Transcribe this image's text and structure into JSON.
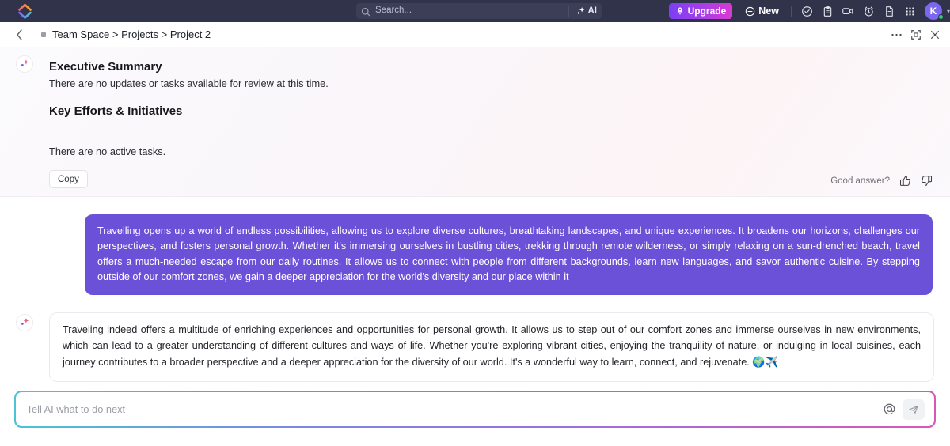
{
  "topbar": {
    "logo_icon": "clickup-logo-icon",
    "search": {
      "icon": "search-icon",
      "placeholder": "Search...",
      "ai_label": "AI",
      "ai_icon": "sparkle-icon"
    },
    "upgrade_label": "Upgrade",
    "upgrade_icon": "rocket-icon",
    "new_label": "New",
    "new_icon": "plus-circle-icon",
    "icons": [
      {
        "name": "check-circle-icon",
        "title": "Tasks"
      },
      {
        "name": "clipboard-icon",
        "title": "Notepad"
      },
      {
        "name": "video-camera-icon",
        "title": "Clip"
      },
      {
        "name": "alarm-clock-icon",
        "title": "Reminders"
      },
      {
        "name": "document-icon",
        "title": "Docs"
      },
      {
        "name": "apps-grid-icon",
        "title": "Apps"
      }
    ],
    "avatar": {
      "initial": "K",
      "status": "online",
      "status_color": "#2ecc71",
      "bg_color": "#7b68ee"
    },
    "bg_color": "#31334a"
  },
  "breadcrumb": {
    "back_icon": "chevron-left-icon",
    "space_dot_color": "#9aa0a6",
    "path": "Team Space > Projects > Project 2",
    "actions": [
      {
        "name": "more-options-icon",
        "glyph": "•••"
      },
      {
        "name": "expand-collapse-icon",
        "glyph": "⌘"
      },
      {
        "name": "close-icon",
        "glyph": "✕"
      }
    ]
  },
  "thread": {
    "ai_answer": {
      "badge_icon": "ai-sparkle-icon",
      "heading_1": "Executive Summary",
      "paragraph_1": "There are no updates or tasks available for review at this time.",
      "heading_2": "Key Efforts & Initiatives",
      "paragraph_2": "There are no active tasks.",
      "copy_label": "Copy",
      "feedback_label": "Good answer?",
      "thumbs_up_icon": "thumbs-up-icon",
      "thumbs_down_icon": "thumbs-down-icon"
    },
    "user_message": {
      "text": "Travelling opens up a world of endless possibilities, allowing us to explore diverse cultures, breathtaking landscapes, and unique experiences. It broadens our horizons, challenges our perspectives, and fosters personal growth. Whether it's immersing ourselves in bustling cities, trekking through remote wilderness, or simply relaxing on a sun-drenched beach, travel offers a much-needed escape from our daily routines. It allows us to connect with people from different backgrounds, learn new languages, and savor authentic cuisine. By stepping outside of our comfort zones, we gain a deeper appreciation for the world's diversity and our place within it",
      "bubble_color": "#6a51d8",
      "text_color": "#ffffff"
    },
    "assistant_reply": {
      "badge_icon": "ai-sparkle-icon",
      "text": "Traveling indeed offers a multitude of enriching experiences and opportunities for personal growth. It allows us to step out of our comfort zones and immerse ourselves in new environments, which can lead to a greater understanding of different cultures and ways of life. Whether you're exploring vibrant cities, enjoying the tranquility of nature, or indulging in local cuisines, each journey contributes to a broader perspective and a deeper appreciation for the diversity of our world. It's a wonderful way to learn, connect, and rejuvenate. ",
      "emoji": "🌍✈️"
    }
  },
  "composer": {
    "placeholder": "Tell AI what to do next",
    "value": "",
    "mention_icon": "at-mention-icon",
    "send_icon": "send-paper-plane-icon",
    "border_gradient": [
      "#49c4d6",
      "#7a8ae0",
      "#9a6fe0",
      "#d857b8"
    ]
  }
}
